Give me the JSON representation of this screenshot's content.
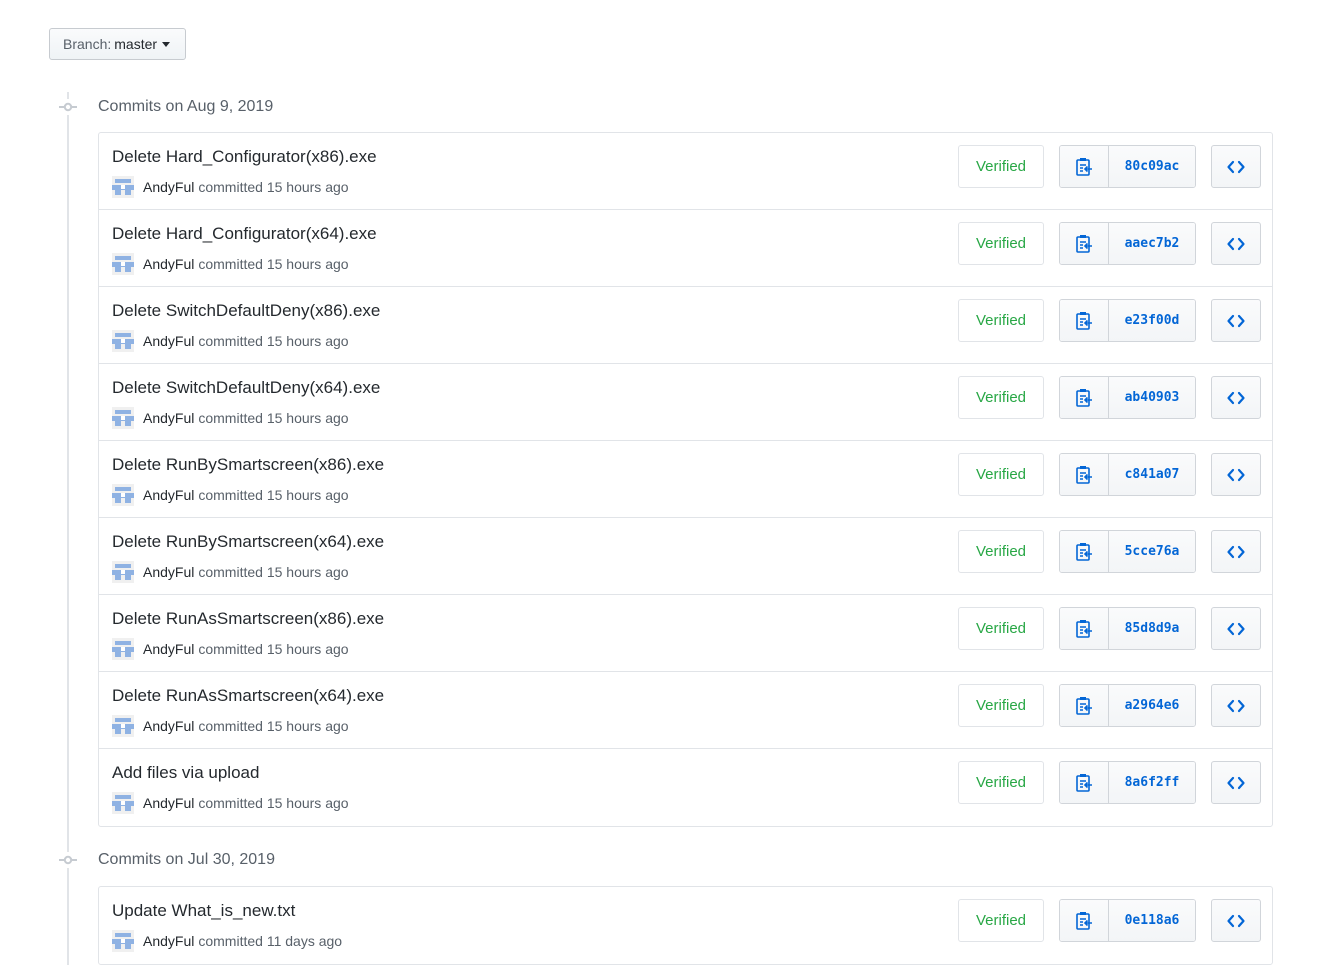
{
  "branch": {
    "prefix": "Branch:",
    "name": "master"
  },
  "groups": [
    {
      "title": "Commits on Aug 9, 2019",
      "commits": [
        {
          "message": "Delete Hard_Configurator(x86).exe",
          "author": "AndyFul",
          "time": "committed 15 hours ago",
          "badge": "Verified",
          "sha": "80c09ac"
        },
        {
          "message": "Delete Hard_Configurator(x64).exe",
          "author": "AndyFul",
          "time": "committed 15 hours ago",
          "badge": "Verified",
          "sha": "aaec7b2"
        },
        {
          "message": "Delete SwitchDefaultDeny(x86).exe",
          "author": "AndyFul",
          "time": "committed 15 hours ago",
          "badge": "Verified",
          "sha": "e23f00d"
        },
        {
          "message": "Delete SwitchDefaultDeny(x64).exe",
          "author": "AndyFul",
          "time": "committed 15 hours ago",
          "badge": "Verified",
          "sha": "ab40903"
        },
        {
          "message": "Delete RunBySmartscreen(x86).exe",
          "author": "AndyFul",
          "time": "committed 15 hours ago",
          "badge": "Verified",
          "sha": "c841a07"
        },
        {
          "message": "Delete RunBySmartscreen(x64).exe",
          "author": "AndyFul",
          "time": "committed 15 hours ago",
          "badge": "Verified",
          "sha": "5cce76a"
        },
        {
          "message": "Delete RunAsSmartscreen(x86).exe",
          "author": "AndyFul",
          "time": "committed 15 hours ago",
          "badge": "Verified",
          "sha": "85d8d9a"
        },
        {
          "message": "Delete RunAsSmartscreen(x64).exe",
          "author": "AndyFul",
          "time": "committed 15 hours ago",
          "badge": "Verified",
          "sha": "a2964e6"
        },
        {
          "message": "Add files via upload",
          "author": "AndyFul",
          "time": "committed 15 hours ago",
          "badge": "Verified",
          "sha": "8a6f2ff"
        }
      ]
    },
    {
      "title": "Commits on Jul 30, 2019",
      "commits": [
        {
          "message": "Update What_is_new.txt",
          "author": "AndyFul",
          "time": "committed 11 days ago",
          "badge": "Verified",
          "sha": "0e118a6"
        }
      ]
    }
  ],
  "icons": {
    "copy": "clipboard-icon",
    "browse": "code-icon",
    "timeline": "git-commit-icon",
    "avatar": "identicon-avatar"
  },
  "colors": {
    "verified": "#28a745",
    "sha": "#0366d6",
    "icon": "#0366d6",
    "border": "#e1e4e8",
    "muted": "#586069",
    "avatar": "#8fb2e3"
  }
}
